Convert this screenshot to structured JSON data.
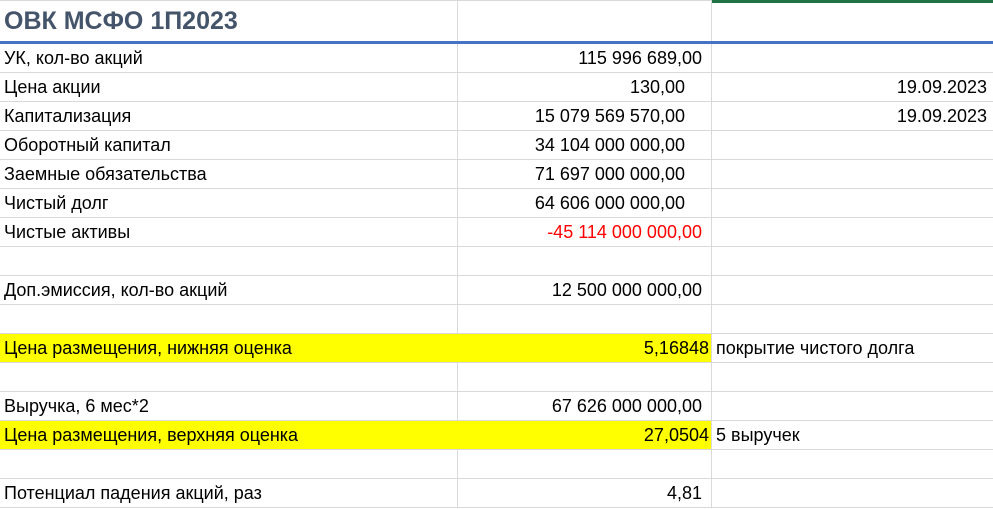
{
  "title": "ОВК МСФО 1П2023",
  "rows": [
    {
      "label": "УК, кол-во акций",
      "value": "115 996 689,00",
      "note": ""
    },
    {
      "label": "Цена акции",
      "value": "130,00",
      "note": "19.09.2023"
    },
    {
      "label": "Капитализация",
      "value": "15 079 569 570,00",
      "note": "19.09.2023"
    },
    {
      "label": "Оборотный капитал",
      "value": "34 104 000 000,00",
      "note": ""
    },
    {
      "label": "Заемные обязательства",
      "value": "71 697 000 000,00",
      "note": ""
    },
    {
      "label": "Чистый долг",
      "value": "64 606 000 000,00",
      "note": ""
    },
    {
      "label": "Чистые активы",
      "value": "-45 114 000 000,00",
      "note": ""
    },
    {
      "label": "",
      "value": "",
      "note": ""
    },
    {
      "label": "Доп.эмиссия, кол-во акций",
      "value": "12 500 000 000,00",
      "note": ""
    },
    {
      "label": "",
      "value": "",
      "note": ""
    },
    {
      "label": "Цена размещения, нижняя оценка",
      "value": "5,16848",
      "note": "покрытие чистого долга"
    },
    {
      "label": "",
      "value": "",
      "note": ""
    },
    {
      "label": "Выручка, 6 мес*2",
      "value": "67 626 000 000,00",
      "note": ""
    },
    {
      "label": "Цена размещения, верхняя оценка",
      "value": "27,0504",
      "note": "5 выручек"
    },
    {
      "label": "",
      "value": "",
      "note": ""
    },
    {
      "label": "Потенциал падения акций, раз",
      "value": "4,81",
      "note": ""
    }
  ],
  "colors": {
    "highlight": "#ffff00",
    "negative": "#ff0000",
    "title": "#44546a",
    "title_border": "#4472c4"
  }
}
